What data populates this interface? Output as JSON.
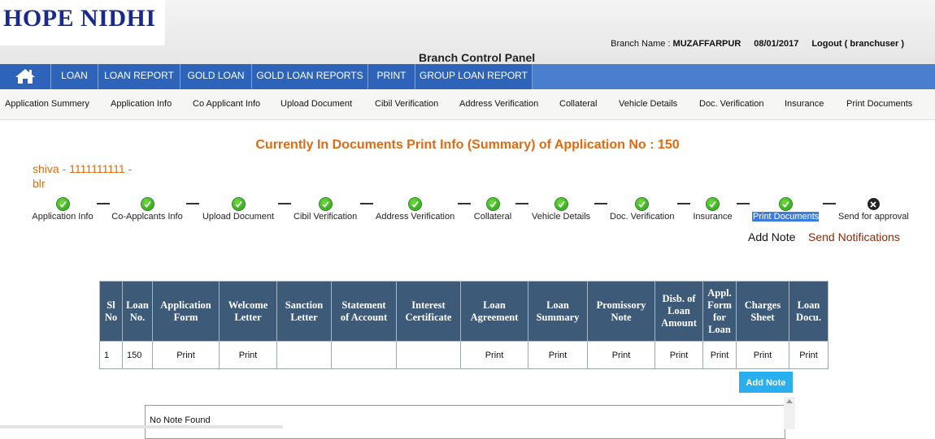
{
  "header": {
    "logo_text": "HOPE NIDHI",
    "branch_label": "Branch Name : ",
    "branch_name": "MUZAFFARPUR",
    "date": "08/01/2017",
    "logout_label": "Logout ( branchuser )",
    "panel_title": "Branch Control Panel"
  },
  "nav": {
    "items": [
      "LOAN",
      "LOAN REPORT",
      "GOLD LOAN",
      "GOLD LOAN REPORTS",
      "PRINT",
      "GROUP LOAN REPORT"
    ]
  },
  "subnav": {
    "items": [
      "Application Summery",
      "Application Info",
      "Co Applicant Info",
      "Upload Document",
      "Cibil Verification",
      "Address Verification",
      "Collateral",
      "Vehicle Details",
      "Doc. Verification",
      "Insurance",
      "Print Documents"
    ]
  },
  "page": {
    "heading": "Currently In Documents Print Info (Summary) of Application No : 150",
    "applicant_line1": "shiva - 1111111111 -",
    "applicant_line2": "blr"
  },
  "steps": [
    {
      "label": "Application Info",
      "status": "done"
    },
    {
      "label": "Co-Applcants Info",
      "status": "done"
    },
    {
      "label": "Upload Document",
      "status": "done"
    },
    {
      "label": "Cibil Verification",
      "status": "done"
    },
    {
      "label": "Address Verification",
      "status": "done"
    },
    {
      "label": "Collateral",
      "status": "done"
    },
    {
      "label": "Vehicle Details",
      "status": "done"
    },
    {
      "label": "Doc. Verification",
      "status": "done"
    },
    {
      "label": "Insurance",
      "status": "done"
    },
    {
      "label": "Print Documents",
      "status": "done"
    },
    {
      "label": "Send for approval",
      "status": "pending"
    }
  ],
  "links": {
    "add_note": "Add Note",
    "send_notifications": "Send Notifications"
  },
  "table": {
    "headers": [
      [
        "Sl",
        "No"
      ],
      [
        "Loan",
        "No."
      ],
      [
        "Application",
        "Form"
      ],
      [
        "Welcome",
        "Letter"
      ],
      [
        "Sanction",
        "Letter"
      ],
      [
        "Statement",
        "of Account"
      ],
      [
        "Interest",
        "Certificate"
      ],
      [
        "Loan",
        "Agreement"
      ],
      [
        "Loan",
        "Summary"
      ],
      [
        "Promissory",
        "Note"
      ],
      [
        "Disb. of",
        "Loan",
        "Amount"
      ],
      [
        "Appl.",
        "Form",
        "for",
        "Loan"
      ],
      [
        "Charges",
        "Sheet"
      ],
      [
        "Loan",
        "Docu."
      ]
    ],
    "rows": [
      [
        "1",
        "150",
        "Print",
        "Print",
        "",
        "",
        "",
        "Print",
        "Print",
        "Print",
        "Print",
        "Print",
        "Print",
        "Print"
      ]
    ]
  },
  "notes": {
    "button_label": "Add Note",
    "empty_text": "No Note Found"
  },
  "colors": {
    "nav_bg": "#4a7fd0",
    "nav_item_bg": "#2d63b8",
    "accent_orange": "#e06a10",
    "table_header_bg": "#3d5a79",
    "button_blue": "#29aef0"
  }
}
